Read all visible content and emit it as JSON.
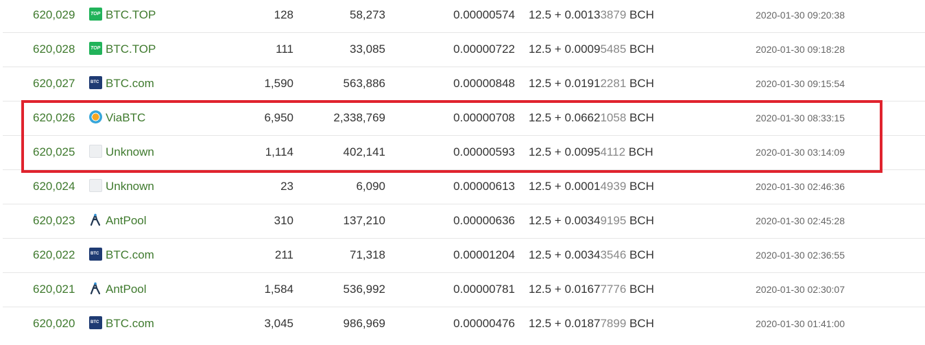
{
  "rows": [
    {
      "height": "620,029",
      "pool": "BTC.TOP",
      "pool_icon": "btctop-icon",
      "txs": "128",
      "size": "58,273",
      "fee": "0.00000574",
      "reward_prefix": "12.5 + 0.0013",
      "reward_dim": "3879",
      "reward_unit": " BCH",
      "time": "2020-01-30 09:20:38"
    },
    {
      "height": "620,028",
      "pool": "BTC.TOP",
      "pool_icon": "btctop-icon",
      "txs": "111",
      "size": "33,085",
      "fee": "0.00000722",
      "reward_prefix": "12.5 + 0.0009",
      "reward_dim": "5485",
      "reward_unit": " BCH",
      "time": "2020-01-30 09:18:28"
    },
    {
      "height": "620,027",
      "pool": "BTC.com",
      "pool_icon": "btccom-icon",
      "txs": "1,590",
      "size": "563,886",
      "fee": "0.00000848",
      "reward_prefix": "12.5 + 0.0191",
      "reward_dim": "2281",
      "reward_unit": " BCH",
      "time": "2020-01-30 09:15:54"
    },
    {
      "height": "620,026",
      "pool": "ViaBTC",
      "pool_icon": "viabtc-icon",
      "txs": "6,950",
      "size": "2,338,769",
      "fee": "0.00000708",
      "reward_prefix": "12.5 + 0.0662",
      "reward_dim": "1058",
      "reward_unit": " BCH",
      "time": "2020-01-30 08:33:15"
    },
    {
      "height": "620,025",
      "pool": "Unknown",
      "pool_icon": "unknown-icon",
      "txs": "1,114",
      "size": "402,141",
      "fee": "0.00000593",
      "reward_prefix": "12.5 + 0.0095",
      "reward_dim": "4112",
      "reward_unit": " BCH",
      "time": "2020-01-30 03:14:09"
    },
    {
      "height": "620,024",
      "pool": "Unknown",
      "pool_icon": "unknown-icon",
      "txs": "23",
      "size": "6,090",
      "fee": "0.00000613",
      "reward_prefix": "12.5 + 0.0001",
      "reward_dim": "4939",
      "reward_unit": " BCH",
      "time": "2020-01-30 02:46:36"
    },
    {
      "height": "620,023",
      "pool": "AntPool",
      "pool_icon": "antpool-icon",
      "txs": "310",
      "size": "137,210",
      "fee": "0.00000636",
      "reward_prefix": "12.5 + 0.0034",
      "reward_dim": "9195",
      "reward_unit": " BCH",
      "time": "2020-01-30 02:45:28"
    },
    {
      "height": "620,022",
      "pool": "BTC.com",
      "pool_icon": "btccom-icon",
      "txs": "211",
      "size": "71,318",
      "fee": "0.00001204",
      "reward_prefix": "12.5 + 0.0034",
      "reward_dim": "3546",
      "reward_unit": " BCH",
      "time": "2020-01-30 02:36:55"
    },
    {
      "height": "620,021",
      "pool": "AntPool",
      "pool_icon": "antpool-icon",
      "txs": "1,584",
      "size": "536,992",
      "fee": "0.00000781",
      "reward_prefix": "12.5 + 0.0167",
      "reward_dim": "7776",
      "reward_unit": " BCH",
      "time": "2020-01-30 02:30:07"
    },
    {
      "height": "620,020",
      "pool": "BTC.com",
      "pool_icon": "btccom-icon",
      "txs": "3,045",
      "size": "986,969",
      "fee": "0.00000476",
      "reward_prefix": "12.5 + 0.0187",
      "reward_dim": "7899",
      "reward_unit": " BCH",
      "time": "2020-01-30 01:41:00"
    }
  ],
  "colors": {
    "link_green": "#3f7a2e",
    "highlight_red": "#e0232e",
    "row_divider": "#e6e6e6"
  }
}
